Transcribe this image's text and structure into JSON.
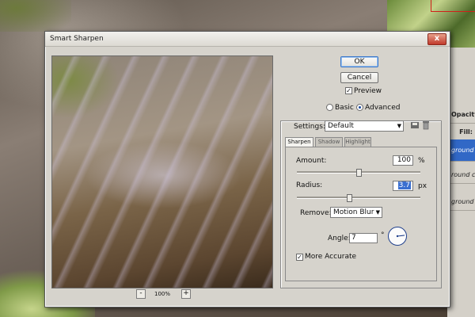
{
  "background": {
    "panel": {
      "opacity_label": "Opacity:",
      "fill_label": "Fill:",
      "layer_1": "ground co",
      "layer_2": "round cop",
      "layer_3": "ground"
    }
  },
  "dialog": {
    "title": "Smart Sharpen",
    "close_glyph": "x",
    "ok_label": "OK",
    "cancel_label": "Cancel",
    "preview_label": "Preview",
    "preview_checked_glyph": "✓",
    "mode": {
      "basic_label": "Basic",
      "advanced_label": "Advanced",
      "selected": "Advanced"
    },
    "settings": {
      "label": "Settings:",
      "value": "Default"
    },
    "tabs": [
      {
        "label": "Sharpen",
        "active": true
      },
      {
        "label": "Shadow",
        "active": false
      },
      {
        "label": "Highlight",
        "active": false
      }
    ],
    "amount": {
      "label": "Amount:",
      "value": "100",
      "unit": "%",
      "slider_fraction": 0.5
    },
    "radius": {
      "label": "Radius:",
      "value": "3.7",
      "unit": "px",
      "slider_fraction": 0.42
    },
    "remove": {
      "label": "Remove:",
      "value": "Motion Blur"
    },
    "angle": {
      "label": "Angle:",
      "value": "7",
      "unit": "°",
      "degrees": 7
    },
    "more_accurate": {
      "label": "More Accurate",
      "checked": true,
      "checked_glyph": "✓"
    },
    "zoom": {
      "level": "100%",
      "minus_glyph": "-",
      "plus_glyph": "+"
    },
    "dropdown_arrow": "▼"
  }
}
